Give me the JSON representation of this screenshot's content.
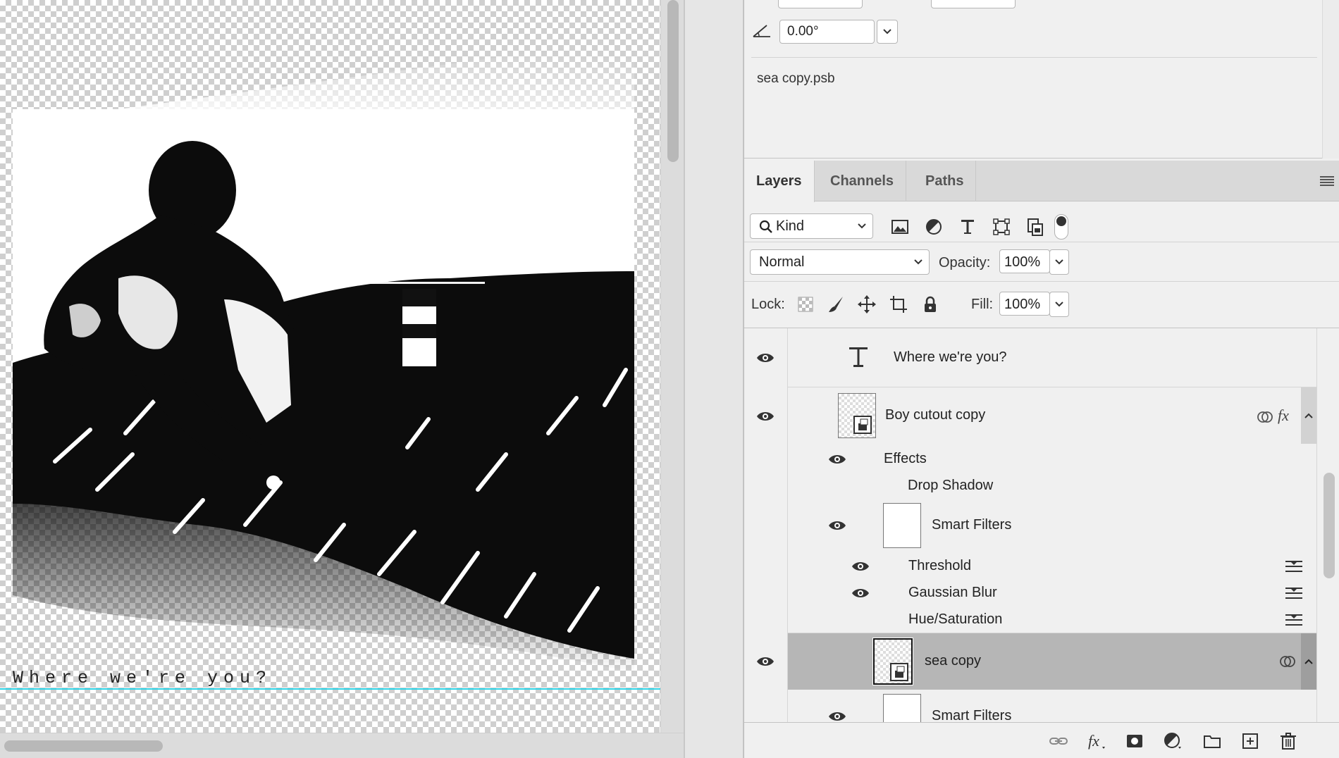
{
  "canvas": {
    "caption": "Where we're you?"
  },
  "properties": {
    "angle_value": "0.00°",
    "file_name": "sea copy.psb"
  },
  "tabs": [
    {
      "label": "Layers",
      "active": true
    },
    {
      "label": "Channels",
      "active": false
    },
    {
      "label": "Paths",
      "active": false
    }
  ],
  "filter": {
    "kind_label": "Kind",
    "icons": [
      "image-filter-icon",
      "adjustment-filter-icon",
      "type-filter-icon",
      "shape-filter-icon",
      "smart-object-filter-icon"
    ]
  },
  "blend": {
    "mode": "Normal",
    "opacity_label": "Opacity:",
    "opacity_value": "100%"
  },
  "lock": {
    "label": "Lock:",
    "fill_label": "Fill:",
    "fill_value": "100%"
  },
  "layers": {
    "text_layer": "Where we're you?",
    "boy_layer": "Boy cutout copy",
    "effects": "Effects",
    "drop_shadow": "Drop Shadow",
    "smart_filters": "Smart Filters",
    "threshold": "Threshold",
    "gaussian_blur": "Gaussian Blur",
    "hue_saturation": "Hue/Saturation",
    "sea_layer": "sea copy",
    "sea_smart_filters": "Smart Filters"
  },
  "colors": {
    "guide": "#2fd3e6",
    "selected_row": "#b6b6b6",
    "panel_bg": "#f0f0f0"
  }
}
